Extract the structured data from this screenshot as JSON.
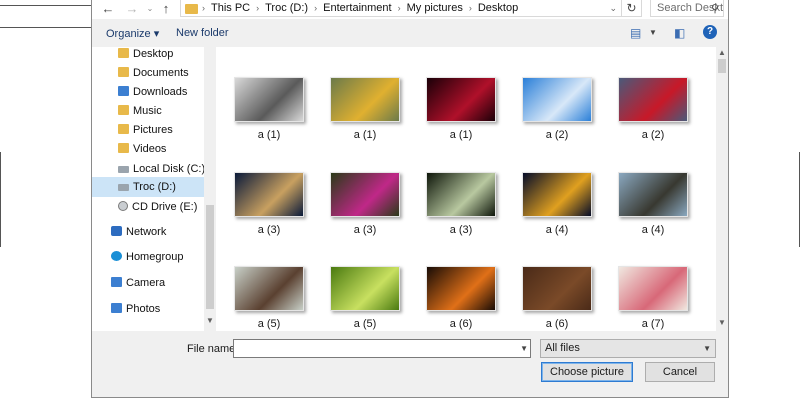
{
  "navigation": {
    "back_icon": "back-arrow-icon",
    "forward_icon": "forward-arrow-icon",
    "recent_icon": "chevron-down-icon",
    "up_icon": "up-arrow-icon"
  },
  "breadcrumb": {
    "items": [
      "This PC",
      "Troc (D:)",
      "Entertainment",
      "My pictures",
      "Desktop"
    ]
  },
  "search": {
    "placeholder": "Search Desktop"
  },
  "toolbar": {
    "organize_label": "Organize ▾",
    "new_folder_label": "New folder",
    "view_icon": "view-options-icon",
    "preview_icon": "preview-pane-icon",
    "help_label": "?"
  },
  "sidebar": {
    "items": [
      {
        "label": "Desktop",
        "icon": "folder-icon"
      },
      {
        "label": "Documents",
        "icon": "documents-icon"
      },
      {
        "label": "Downloads",
        "icon": "downloads-icon"
      },
      {
        "label": "Music",
        "icon": "music-icon"
      },
      {
        "label": "Pictures",
        "icon": "pictures-icon"
      },
      {
        "label": "Videos",
        "icon": "videos-icon"
      },
      {
        "label": "Local Disk (C:)",
        "icon": "drive-icon"
      },
      {
        "label": "Troc (D:)",
        "icon": "drive-icon"
      },
      {
        "label": "CD Drive (E:)",
        "icon": "cd-drive-icon"
      },
      {
        "label": "Network",
        "icon": "network-icon"
      },
      {
        "label": "Homegroup",
        "icon": "homegroup-icon"
      },
      {
        "label": "Camera",
        "icon": "camera-icon"
      },
      {
        "label": "Photos",
        "icon": "photos-icon"
      }
    ],
    "selected": "Troc (D:)"
  },
  "files": [
    {
      "name": "a (1)",
      "colors": [
        "#d9d9d9",
        "#5a5a5a"
      ]
    },
    {
      "name": "a (1)",
      "colors": [
        "#6b7a4a",
        "#e0b030"
      ]
    },
    {
      "name": "a (1)",
      "colors": [
        "#1a0008",
        "#b0102a"
      ]
    },
    {
      "name": "a (2)",
      "colors": [
        "#2a7fd8",
        "#d8e8f8"
      ]
    },
    {
      "name": "a (2)",
      "colors": [
        "#4a5a7a",
        "#c81828"
      ]
    },
    {
      "name": "a (3)",
      "colors": [
        "#0a1a3a",
        "#c8a060"
      ]
    },
    {
      "name": "a (3)",
      "colors": [
        "#2a3a18",
        "#c02888"
      ]
    },
    {
      "name": "a (3)",
      "colors": [
        "#0e160a",
        "#b8c8a0"
      ]
    },
    {
      "name": "a (4)",
      "colors": [
        "#050c28",
        "#e0a020"
      ]
    },
    {
      "name": "a (4)",
      "colors": [
        "#8aa8c0",
        "#383830"
      ]
    },
    {
      "name": "a (5)",
      "colors": [
        "#c8d0c8",
        "#5a4030"
      ]
    },
    {
      "name": "a (5)",
      "colors": [
        "#4a7a10",
        "#c8e060"
      ]
    },
    {
      "name": "a (6)",
      "colors": [
        "#180c06",
        "#e07018"
      ]
    },
    {
      "name": "a (6)",
      "colors": [
        "#4a2a18",
        "#7a4a28"
      ]
    },
    {
      "name": "a (7)",
      "colors": [
        "#f0e8e0",
        "#d86878"
      ]
    }
  ],
  "footer": {
    "file_name_label": "File name:",
    "file_name_value": "",
    "filter_value": "All files",
    "choose_label": "Choose picture",
    "cancel_label": "Cancel"
  },
  "colors": {
    "accent": "#2e7bd2",
    "selection": "#cce4f7",
    "folder": "#e8b94a"
  }
}
